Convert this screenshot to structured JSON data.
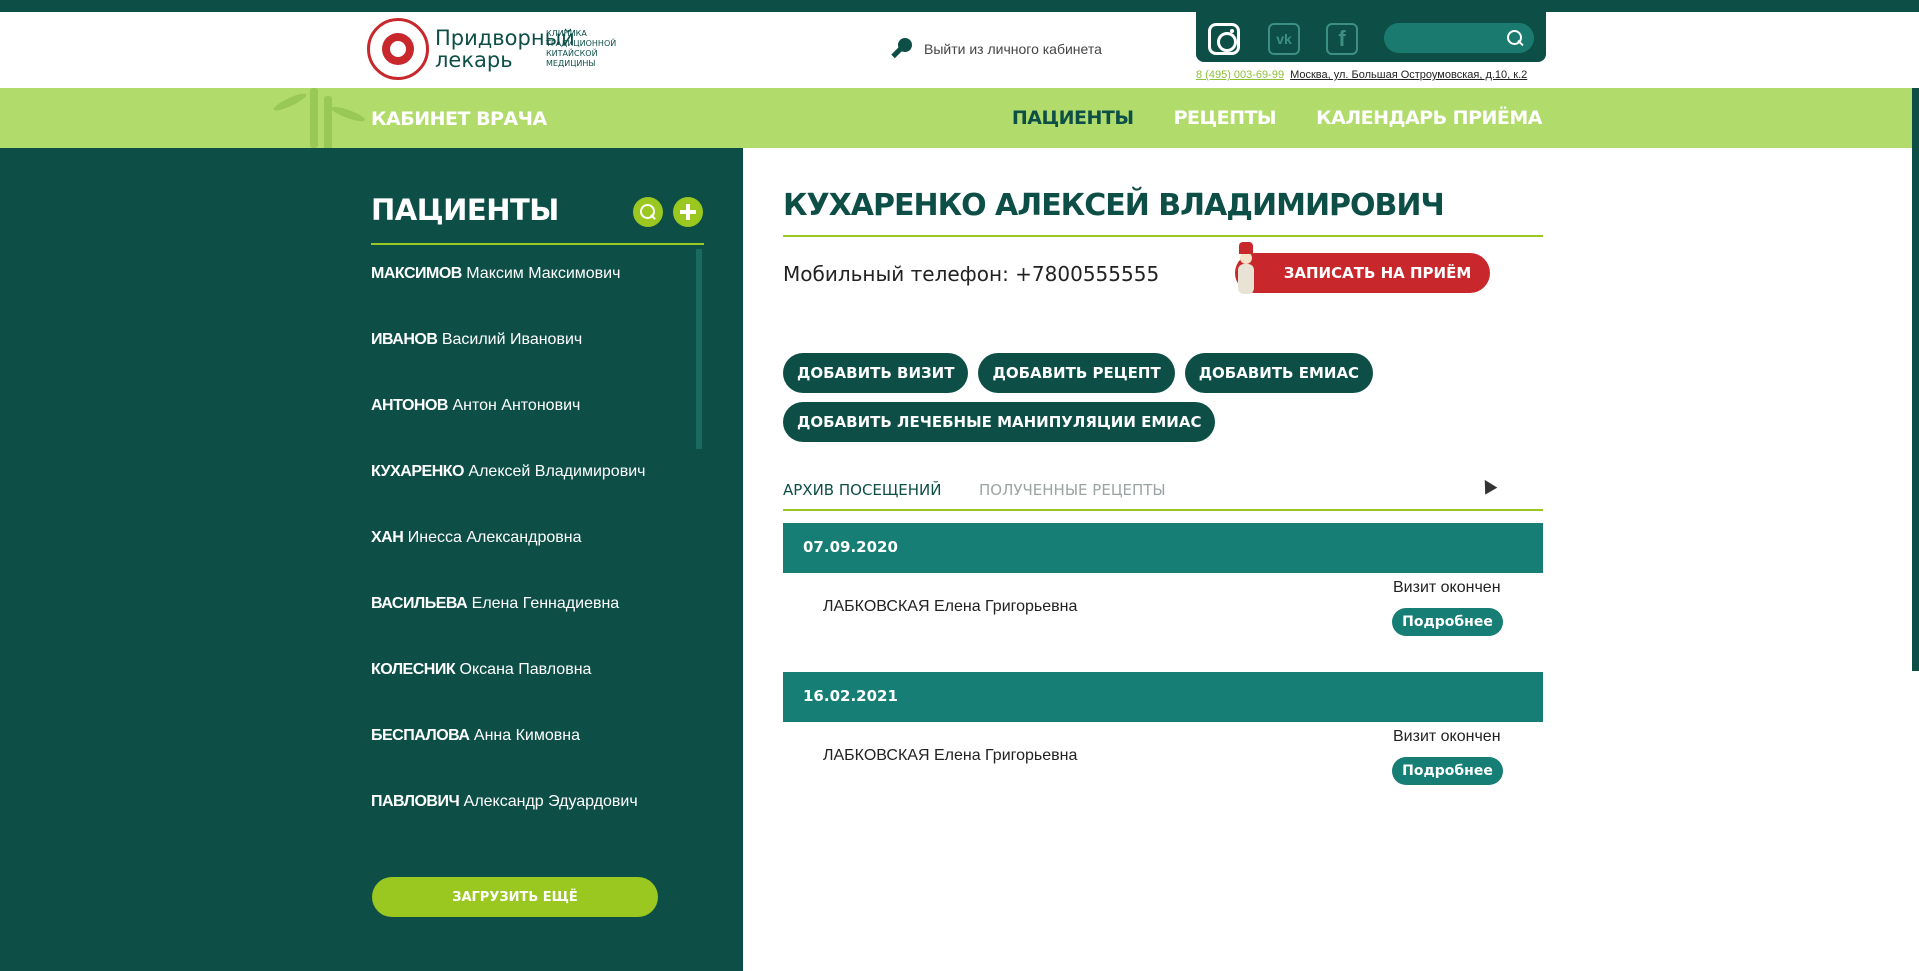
{
  "header": {
    "logo_name": "Придворный лекарь",
    "logo_subtitle": "КЛИНИКА ТРАДИЦИОННОЙ КИТАЙСКОЙ МЕДИЦИНЫ",
    "logout_label": "Выйти из личного кабинета",
    "search_placeholder": "",
    "phone": "8 (495) 003-69-99",
    "address": "Москва, ул. Большая Остроумовская, д.10, к.2",
    "social": [
      "instagram-icon",
      "vk-icon",
      "facebook-icon"
    ]
  },
  "nav": {
    "cabinet_title": "КАБИНЕТ ВРАЧА",
    "items": [
      "ПАЦИЕНТЫ",
      "РЕЦЕПТЫ",
      "КАЛЕНДАРЬ ПРИЁМА"
    ],
    "active": "ПАЦИЕНТЫ"
  },
  "sidebar": {
    "title": "ПАЦИЕНТЫ",
    "patients": [
      {
        "surname": "МАКСИМОВ",
        "name": "Максим Максимович"
      },
      {
        "surname": "ИВАНОВ",
        "name": "Василий Иванович"
      },
      {
        "surname": "АНТОНОВ",
        "name": "Антон Антонович"
      },
      {
        "surname": "КУХАРЕНКО",
        "name": "Алексей Владимирович"
      },
      {
        "surname": "ХАН",
        "name": "Инесса Александровна"
      },
      {
        "surname": "ВАСИЛЬЕВА",
        "name": "Елена Геннадиевна"
      },
      {
        "surname": "КОЛЕСНИК",
        "name": "Оксана Павловна"
      },
      {
        "surname": "БЕСПАЛОВА",
        "name": "Анна Кимовна"
      },
      {
        "surname": "ПАВЛОВИЧ",
        "name": "Александр Эдуардович"
      }
    ],
    "load_more": "ЗАГРУЗИТЬ ЕЩЁ"
  },
  "patient": {
    "full_name": "КУХАРЕНКО АЛЕКСЕЙ ВЛАДИМИРОВИЧ",
    "phone_label": "Мобильный телефон: +7800555555",
    "book_button": "ЗАПИСАТЬ НА ПРИЁМ"
  },
  "actions": {
    "add_visit": "ДОБАВИТЬ ВИЗИТ",
    "add_recipe": "ДОБАВИТЬ РЕЦЕПТ",
    "add_emias": "ДОБАВИТЬ ЕМИАС",
    "add_manipulations": "ДОБАВИТЬ ЛЕЧЕБНЫЕ МАНИПУЛЯЦИИ ЕМИАС"
  },
  "tabs": {
    "archive": "АРХИВ ПОСЕЩЕНИЙ",
    "recipes": "ПОЛУЧЕННЫЕ РЕЦЕПТЫ"
  },
  "visits": [
    {
      "date": "07.09.2020",
      "doctor_surname": "ЛАБКОВСКАЯ",
      "doctor_name": "Елена Григорьевна",
      "status": "Визит окончен",
      "details": "Подробнее"
    },
    {
      "date": "16.02.2021",
      "doctor_surname": "ЛАБКОВСКАЯ",
      "doctor_name": "Елена Григорьевна",
      "status": "Визит окончен",
      "details": "Подробнее"
    }
  ],
  "colors": {
    "dark_green": "#0d4f47",
    "light_green": "#b1dc6c",
    "accent_green": "#9bc820",
    "teal": "#167e74",
    "red": "#c8272c"
  }
}
